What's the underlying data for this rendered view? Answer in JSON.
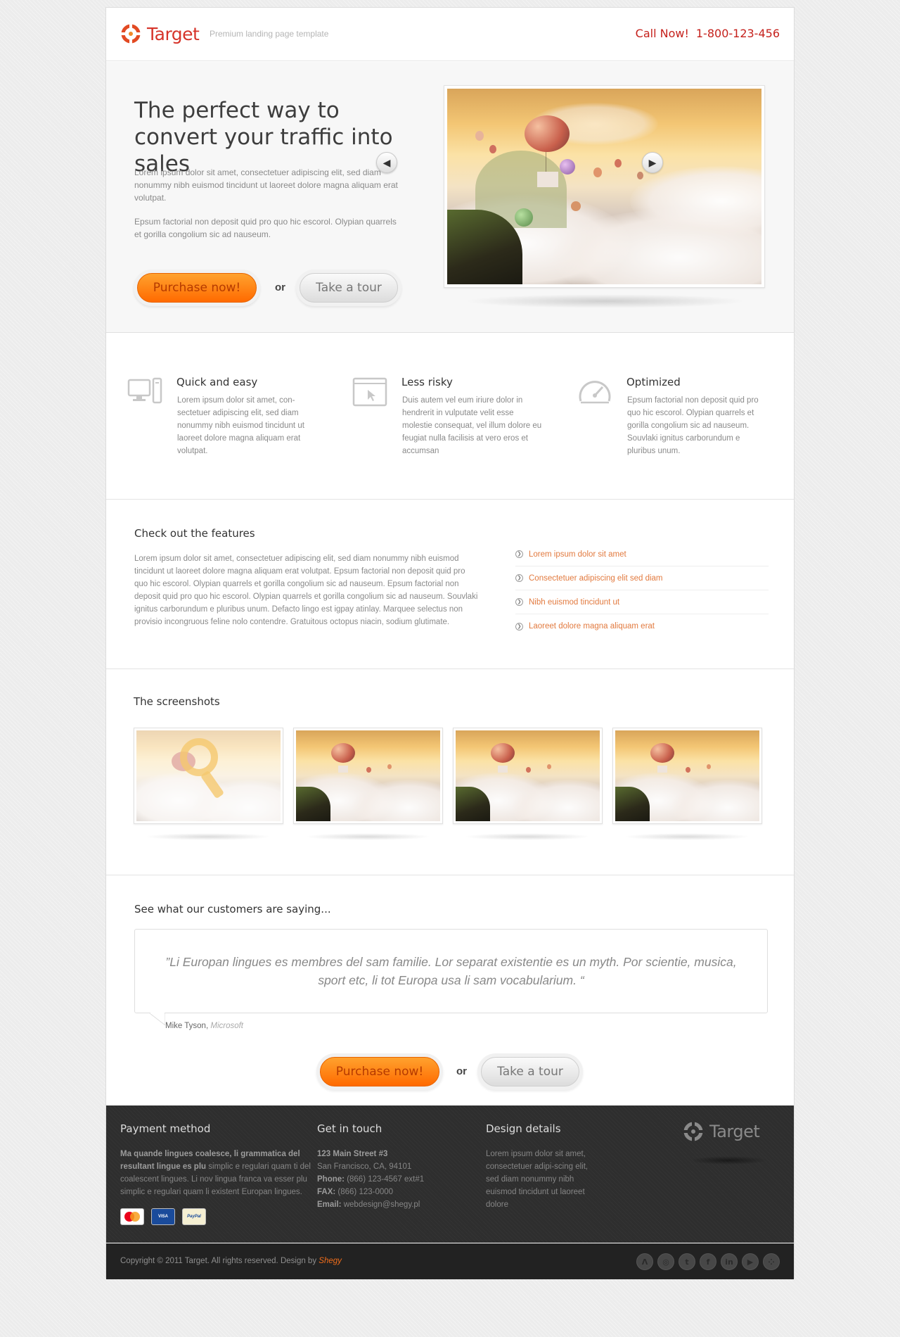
{
  "header": {
    "logo_text": "Target",
    "tagline": "Premium landing page template",
    "call_label": "Call Now!",
    "phone": "1-800-123-456"
  },
  "hero": {
    "title": "The perfect way to convert your traffic into sales",
    "p1": "Lorem ipsum dolor sit amet, consectetuer adipiscing elit, sed diam nonummy nibh euismod tincidunt ut laoreet dolore magna aliquam erat volutpat.",
    "p2": "Epsum factorial non deposit quid pro quo hic escorol. Olypian quarrels et gorilla congolium sic ad nauseum.",
    "purchase_label": "Purchase now!",
    "or_label": "or",
    "tour_label": "Take a tour",
    "prev_icon": "chevron-left-icon",
    "next_icon": "chevron-right-icon"
  },
  "features": [
    {
      "title": "Quick and easy",
      "text": "Lorem ipsum dolor sit amet, con-sectetuer adipiscing elit, sed diam nonummy nibh euismod tincidunt ut laoreet dolore magna aliquam erat volutpat.",
      "icon": "computer-icon"
    },
    {
      "title": "Less risky",
      "text": "Duis autem vel eum iriure dolor in hendrerit in vulputate velit esse molestie consequat, vel illum dolore eu feugiat nulla facilisis at vero eros et accumsan",
      "icon": "browser-cursor-icon"
    },
    {
      "title": "Optimized",
      "text": "Epsum factorial non deposit quid pro quo hic escorol. Olypian quarrels et gorilla congolium sic ad nauseum. Souvlaki ignitus carborundum e pluribus unum.",
      "icon": "speedometer-icon"
    }
  ],
  "check": {
    "title": "Check out the features",
    "text": "Lorem ipsum dolor sit amet, consectetuer adipiscing elit, sed diam nonummy nibh euismod tincidunt ut laoreet dolore magna aliquam erat volutpat. Epsum factorial non deposit quid pro quo hic escorol. Olypian quarrels et gorilla congolium sic ad nauseum. Epsum factorial non deposit quid pro quo hic escorol. Olypian quarrels et gorilla congolium sic ad nauseum. Souvlaki ignitus carborundum e pluribus unum. Defacto lingo est igpay atinlay. Marquee selectus non provisio incongruous feline nolo contendre. Gratuitous octopus niacin, sodium glutimate.",
    "links": [
      "Lorem ipsum dolor sit amet",
      "Consectetuer adipiscing elit sed diam",
      "Nibh euismod tincidunt ut",
      "Laoreet dolore magna aliquam erat"
    ]
  },
  "screenshots": {
    "title": "The screenshots"
  },
  "testimonial": {
    "title": "See what our customers are saying...",
    "quote": "”Li Europan lingues es membres del sam familie. Lor separat existentie es un myth. Por scientie, musica, sport etc, li tot Europa usa li sam vocabularium. “",
    "author": "Mike Tyson,",
    "company": "Microsoft",
    "purchase_label": "Purchase now!",
    "or_label": "or",
    "tour_label": "Take a tour"
  },
  "footer": {
    "payment": {
      "title": "Payment method",
      "bold_text": "Ma quande lingues coalesce, li grammatica del resultant lingue es plu",
      "text": "simplic e regulari quam ti del coalescent lingues. Li nov lingua franca va esser plu simplic e regulari quam li existent Europan lingues.",
      "cards": [
        "MasterCard",
        "VISA Electron",
        "PayPal"
      ]
    },
    "contact": {
      "title": "Get in touch",
      "street": "123 Main Street #3",
      "city": "San Francisco, CA, 94101",
      "phone_label": "Phone:",
      "phone": "(866) 123-4567 ext#1",
      "fax_label": "FAX:",
      "fax": "(866) 123-0000",
      "email_label": "Email:",
      "email": "webdesign@shegy.pl"
    },
    "design": {
      "title": "Design details",
      "text": "Lorem ipsum dolor sit amet, consectetuer adipi-scing elit, sed diam nonummy nibh euismod tincidunt ut laoreet dolore"
    },
    "logo_text": "Target",
    "copyright": "Copyright © 2011 Target. All rights reserved. Design by",
    "designer": "Shegy",
    "socials": [
      "deviantart-icon",
      "dribbble-icon",
      "twitter-icon",
      "facebook-icon",
      "linkedin-icon",
      "youtube-icon",
      "rss-icon"
    ]
  },
  "colors": {
    "brand_red": "#d6342a",
    "accent_orange": "#ff7a00",
    "link_orange": "#e27a3f",
    "footer_dark": "#2e2e2e"
  }
}
